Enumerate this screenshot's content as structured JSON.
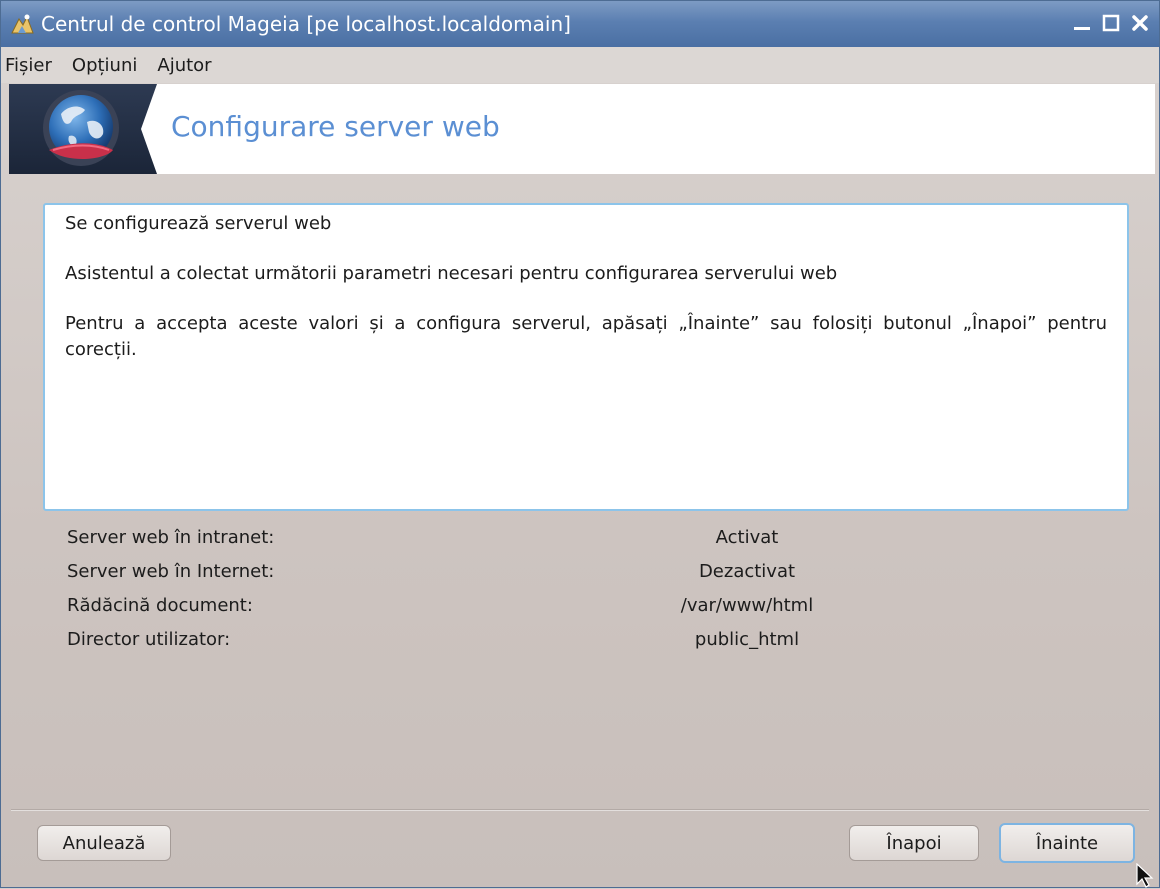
{
  "window": {
    "title": "Centrul de control Mageia  [pe localhost.localdomain]"
  },
  "menu": {
    "items": [
      "Fișier",
      "Opțiuni",
      "Ajutor"
    ]
  },
  "banner": {
    "title": "Configurare server web"
  },
  "message": {
    "line1": "Se configurează serverul web",
    "line2": "Asistentul a colectat următorii parametri necesari pentru configurarea serverului web",
    "line3": "Pentru a accepta aceste valori și a configura serverul, apăsați „Înainte” sau folosiți butonul „Înapoi” pentru corecții."
  },
  "params": [
    {
      "label": "Server web în intranet:",
      "value": "Activat"
    },
    {
      "label": "Server web în Internet:",
      "value": "Dezactivat"
    },
    {
      "label": "Rădăcină document:",
      "value": "/var/www/html"
    },
    {
      "label": "Director utilizator:",
      "value": "public_html"
    }
  ],
  "buttons": {
    "cancel": "Anulează",
    "back": "Înapoi",
    "next": "Înainte"
  },
  "icons": {
    "app": "mageia-control-center-icon",
    "banner": "globe-web-icon",
    "minimize": "minimize-icon",
    "maximize": "maximize-icon",
    "close": "close-icon"
  },
  "colors": {
    "titlebar": "#5b7fb1",
    "banner_title": "#5b8fd3",
    "focus_border": "#7db4e2"
  }
}
